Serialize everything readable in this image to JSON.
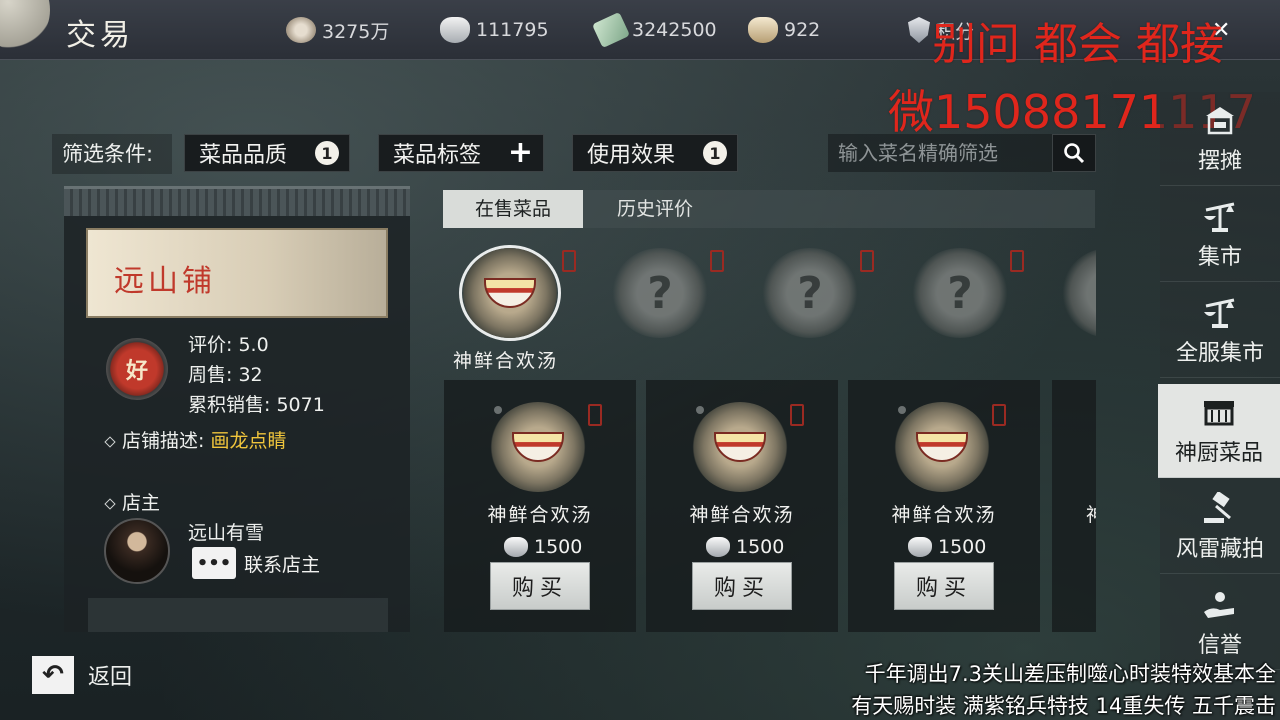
{
  "topbar": {
    "title": "交易",
    "currencies": [
      {
        "icon": "copper-coin-icon",
        "value": "3275万"
      },
      {
        "icon": "silver-ingot-icon",
        "value": "111795"
      },
      {
        "icon": "banknote-icon",
        "value": "3242500"
      },
      {
        "icon": "gold-ingot-icon",
        "value": "922"
      }
    ],
    "points_label": "积分"
  },
  "overlay": {
    "line1": "别问 都会 都接",
    "line2": "微15088171117",
    "footer1": "千年调出7.3关山差压制噬心时装特效基本全",
    "footer2": "有天赐时装 满紫铭兵特技 14重失传 五千震击"
  },
  "filters": {
    "label": "筛选条件:",
    "quality": "菜品品质",
    "quality_count": "1",
    "tags": "菜品标签",
    "effect": "使用效果",
    "effect_count": "1",
    "search_placeholder": "输入菜名精确筛选"
  },
  "shop": {
    "name": "远山铺",
    "seal_char": "好",
    "rating": "评价: 5.0",
    "weekly": "周售: 32",
    "total": "累积销售: 5071",
    "desc_label": "店铺描述: ",
    "desc_value": "画龙点睛",
    "owner_label": "店主",
    "owner_name": "远山有雪",
    "contact_label": "联系店主"
  },
  "tabs": {
    "on_sale": "在售菜品",
    "history": "历史评价"
  },
  "selected_dish_name": "神鲜合欢汤",
  "unknown_mark": "?",
  "listings": [
    {
      "name": "神鲜合欢汤",
      "price": "1500",
      "buy": "购买"
    },
    {
      "name": "神鲜合欢汤",
      "price": "1500",
      "buy": "购买"
    },
    {
      "name": "神鲜合欢汤",
      "price": "1500",
      "buy": "购买"
    }
  ],
  "partial_card_char": "神",
  "right_nav": [
    {
      "label": "摆摊",
      "icon": "stall-icon"
    },
    {
      "label": "集市",
      "icon": "scale-icon"
    },
    {
      "label": "全服集市",
      "icon": "scale-icon"
    },
    {
      "label": "神厨菜品",
      "icon": "kitchen-icon"
    },
    {
      "label": "风雷藏拍",
      "icon": "gavel-icon"
    },
    {
      "label": "信誉",
      "icon": "hand-icon"
    }
  ],
  "back_label": "返回",
  "colors": {
    "accent_yellow": "#f0c53c",
    "overlay_red": "#e0261c",
    "seal_red": "#c0392b"
  }
}
